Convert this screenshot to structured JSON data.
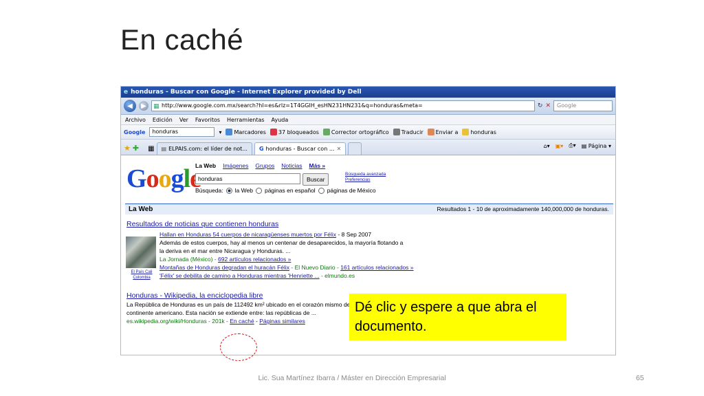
{
  "slide": {
    "title": "En caché",
    "callout": "Dé clic y espere a que abra el documento.",
    "footer": "Lic. Sua Martínez Ibarra / Máster en Dirección Empresarial",
    "page_number": "65"
  },
  "browser": {
    "window_title": "honduras - Buscar con Google - Internet Explorer provided by Dell",
    "address": "http://www.google.com.mx/search?hl=es&rlz=1T4GGIH_esHN231HN231&q=honduras&meta=",
    "search_placeholder": "Google",
    "menu": [
      "Archivo",
      "Edición",
      "Ver",
      "Favoritos",
      "Herramientas",
      "Ayuda"
    ],
    "toolbar": {
      "google_label": "Google",
      "query": "honduras",
      "marcadores": "Marcadores",
      "bloqueados": "37 bloqueados",
      "corrector": "Corrector ortográfico",
      "traducir": "Traducir",
      "enviar": "Enviar a",
      "highlight": "honduras"
    },
    "tabs": [
      {
        "label": "ELPAIS.com: el líder de not..."
      },
      {
        "label": "honduras - Buscar con ..."
      }
    ],
    "pagina_label": "Página"
  },
  "google": {
    "nav": [
      "La Web",
      "Imágenes",
      "Grupos",
      "Noticias",
      "Más »"
    ],
    "query": "honduras",
    "button": "Buscar",
    "advanced": "Búsqueda avanzada",
    "prefs": "Preferencias",
    "scope_label": "Búsqueda:",
    "scopes": [
      "la Web",
      "páginas en español",
      "páginas de México"
    ],
    "bar_label": "La Web",
    "stats": "Resultados 1 - 10 de aproximadamente 140,000,000 de honduras.",
    "news": {
      "heading": "Resultados de noticias que contienen honduras",
      "item1_title": "Hallan en Honduras 54 cuerpos de nicaragüenses muertos por Félix",
      "item1_date": " - 8 Sep 2007",
      "item1_line1": "Además de estos cuerpos, hay al menos un centenar de desaparecidos, la mayoría flotando a",
      "item1_line2": "la deriva en el mar entre Nicaragua y Honduras. ...",
      "item1_source": "La Jornada (México) - ",
      "item1_related": "692 artículos relacionados »",
      "item2_title": "Montañas de Honduras degradan el huracán Félix",
      "item2_source": " - El Nuevo Diario - ",
      "item2_related": "161 artículos relacionados »",
      "item3_title": "'Félix' se debilita de camino a Honduras mientras 'Henriette ...",
      "item3_source": " - elmundo.es",
      "thumb_caption": "El País Cali\nColombia"
    },
    "result": {
      "title": "Honduras - Wikipedia, la enciclopedia libre",
      "line1": "La República de Honduras es un país de 112492 km² ubicado en el corazón mismo del",
      "line2": "continente americano. Esta nación se extiende entre: las repúblicas de ...",
      "url": "es.wikipedia.org/wiki/Honduras - 201k - ",
      "cache": "En caché",
      "sep": " - ",
      "similar": "Páginas similares"
    }
  }
}
